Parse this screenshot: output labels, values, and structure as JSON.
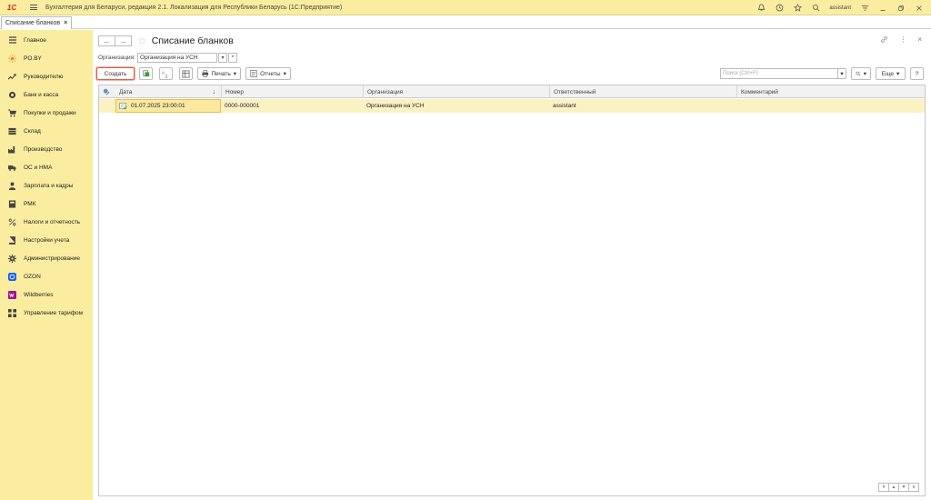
{
  "app": {
    "logo": "1С",
    "title": "Бухгалтерия для Беларуси, редакция 2.1. Локализация для Республики Беларусь   (1С:Предприятие)",
    "user": "assistant"
  },
  "tabs": [
    {
      "label": "Списание бланков",
      "close": "×"
    }
  ],
  "sidebar": {
    "items": [
      {
        "label": "Главное",
        "icon": "menu-lines-icon"
      },
      {
        "label": "PO.BY",
        "icon": "sun-icon"
      },
      {
        "label": "Руководителю",
        "icon": "trend-icon"
      },
      {
        "label": "Банк и касса",
        "icon": "coin-icon"
      },
      {
        "label": "Покупки и продажи",
        "icon": "cart-icon"
      },
      {
        "label": "Склад",
        "icon": "warehouse-icon"
      },
      {
        "label": "Производство",
        "icon": "factory-icon"
      },
      {
        "label": "ОС и НМА",
        "icon": "truck-icon"
      },
      {
        "label": "Зарплата и кадры",
        "icon": "person-icon"
      },
      {
        "label": "РМК",
        "icon": "register-icon"
      },
      {
        "label": "Налоги и отчетность",
        "icon": "percent-icon"
      },
      {
        "label": "Настройки учета",
        "icon": "book-icon"
      },
      {
        "label": "Администрирование",
        "icon": "gear-icon"
      },
      {
        "label": "OZON",
        "icon": "ozon-icon"
      },
      {
        "label": "Wildberries",
        "icon": "wildberries-icon"
      },
      {
        "label": "Управление тарифом",
        "icon": "grid-icon"
      }
    ]
  },
  "page": {
    "title": "Списание бланков",
    "back": "←",
    "forward": "→",
    "org_label": "Организация:",
    "org_value": "Организация на УСН"
  },
  "toolbar": {
    "create": "Создать",
    "print": "Печать",
    "reports": "Отчеты",
    "search_placeholder": "Поиск (Ctrl+F)",
    "more": "Еще",
    "help": "?"
  },
  "table": {
    "columns": [
      "Дата",
      "Номер",
      "Организация",
      "Ответственный",
      "Комментарий"
    ],
    "rows": [
      {
        "date": "01.07.2025 23:00:01",
        "number": "0000-000001",
        "org": "Организация на УСН",
        "responsible": "assistant",
        "comment": ""
      }
    ]
  },
  "colors": {
    "sidebar_bg": "#fbeda0",
    "selected_row": "#fbf2c4",
    "accent": "#e35b45"
  }
}
